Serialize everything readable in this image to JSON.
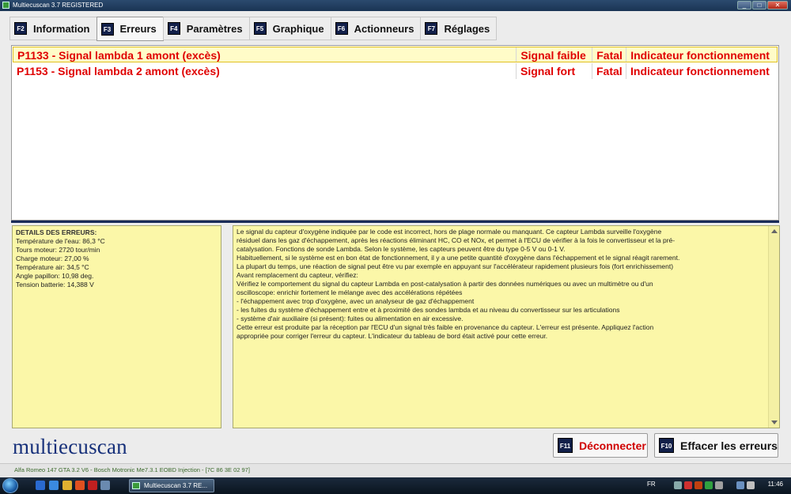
{
  "window": {
    "title": "Multiecuscan 3.7 REGISTERED",
    "buttons": {
      "minimize": "_",
      "maximize": "□",
      "close": "✕"
    }
  },
  "tabs": [
    {
      "key": "F2",
      "label": "Information"
    },
    {
      "key": "F3",
      "label": "Erreurs",
      "active": true
    },
    {
      "key": "F4",
      "label": "Paramètres"
    },
    {
      "key": "F5",
      "label": "Graphique"
    },
    {
      "key": "F6",
      "label": "Actionneurs"
    },
    {
      "key": "F7",
      "label": "Réglages"
    }
  ],
  "errors": [
    {
      "code": "P1133 - Signal lambda 1 amont (excès)",
      "signal": "Signal faible",
      "severity": "Fatal",
      "indicator": "Indicateur fonctionnement",
      "selected": true
    },
    {
      "code": "P1153 - Signal lambda 2 amont (excès)",
      "signal": "Signal fort",
      "severity": "Fatal",
      "indicator": "Indicateur fonctionnement",
      "selected": false
    }
  ],
  "details": {
    "title": "DETAILS DES ERREURS:",
    "lines": [
      "Température de l'eau: 86,3 °C",
      "Tours moteur: 2720 tour/min",
      "Charge moteur: 27,00 %",
      "Température air: 34,5 °C",
      "Angle papillon: 10,98 deg.",
      "Tension batterie: 14,388 V"
    ]
  },
  "description": {
    "lines": [
      "Le signal du capteur d'oxygène indiquée par le code est incorrect, hors de plage normale ou manquant. Ce capteur Lambda surveille l'oxygène",
      "résiduel dans les gaz d'échappement, après les réactions éliminant HC, CO et NOx, et permet à l'ECU de vérifier à la fois le convertisseur et la pré-",
      "catalysation. Fonctions de sonde Lambda. Selon le système, les capteurs peuvent être du type 0-5 V ou 0-1 V.",
      "Habituellement, si le système est en bon état de fonctionnement, il y a une petite quantité d'oxygène dans l'échappement et le signal réagit rarement.",
      "La plupart du temps, une réaction de signal peut être vu par exemple en appuyant sur l'accélérateur rapidement plusieurs fois (fort enrichissement)",
      "Avant remplacement du capteur, vérifiez:",
      "Vérifiez le comportement du signal du capteur Lambda en post-catalysation à partir des données numériques ou avec un multimètre ou d'un",
      "oscilloscope: enrichir fortement le mélange avec des accélérations répétées",
      " - l'échappement avec trop d'oxygène, avec un analyseur de gaz d'échappement",
      " - les fuites du système d'échappement entre et à proximité des sondes lambda et au niveau du convertisseur sur les articulations",
      " - système d'air auxiliaire (si présent): fuites ou alimentation en air excessive.",
      "Cette erreur est produite par la réception par l'ECU d'un signal très faible en provenance du capteur. L'erreur est présente. Appliquez l'action",
      "appropriée pour corriger l'erreur du capteur. L'indicateur du tableau de bord était activé pour cette erreur."
    ]
  },
  "logo": "multiecuscan",
  "actions": {
    "disconnect": {
      "key": "F11",
      "label": "Déconnecter",
      "color": "#d00000"
    },
    "clear": {
      "key": "F10",
      "label": "Effacer les erreurs"
    }
  },
  "status": "Alfa Romeo 147 GTA 3.2 V6 - Bosch Motronic Me7.3.1 EOBD Injection - [7C 86 3E 02 97]",
  "taskbar": {
    "item": "Multiecuscan 3.7 RE...",
    "language": "FR",
    "clock": "11:46"
  }
}
